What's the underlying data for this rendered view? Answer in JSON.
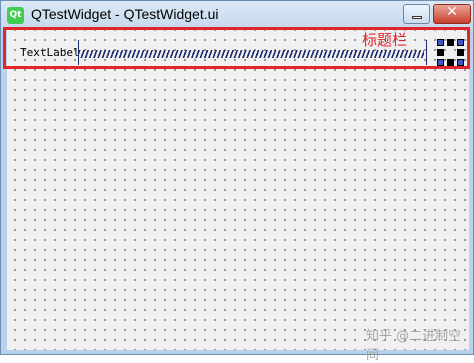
{
  "window": {
    "icon_text": "Qt",
    "title": "QTestWidget - QTestWidget.ui",
    "close_glyph": "✕"
  },
  "form": {
    "label_text": "TextLabel"
  },
  "annotation": {
    "text": "标题栏",
    "color": "#e0262b"
  },
  "watermark": {
    "text": "知乎 @二进制空间"
  },
  "icons": [
    "qt-logo-icon",
    "minimize-icon",
    "close-icon",
    "horizontal-spacer-icon",
    "grid-layout-icon"
  ]
}
